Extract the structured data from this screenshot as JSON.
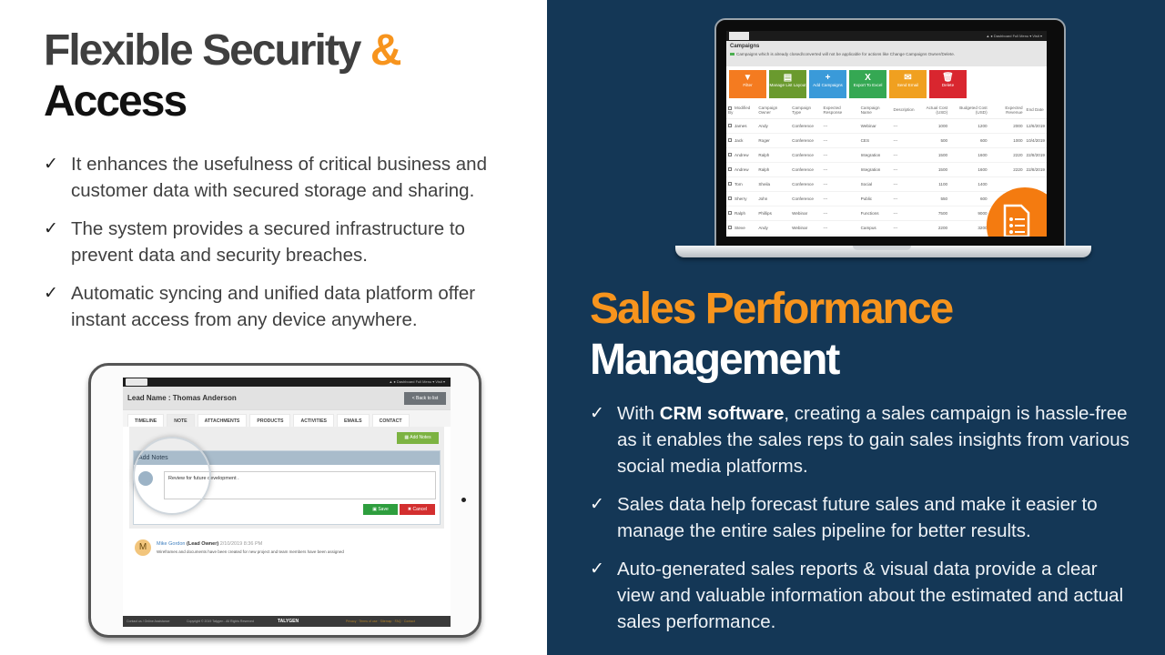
{
  "left": {
    "title_line1": "Flexible Security",
    "title_amp": "&",
    "title_line2": "Access",
    "bullets": [
      "It enhances the usefulness of critical business and customer data with secured storage and sharing.",
      "The system provides a secured infrastructure to prevent data and security breaches.",
      "Automatic syncing and unified data platform offer instant access from any device anywhere."
    ],
    "check_icon": "✓"
  },
  "tablet": {
    "topbar_right": "▲  ●  Dashboard   Full Menu ▾   Visit ▾",
    "lead_title": "Lead Name : Thomas Anderson",
    "back_button": "< Back to list",
    "tabs": [
      "TIMELINE",
      "NOTE",
      "ATTACHMENTS",
      "PRODUCTS",
      "ACTIVITIES",
      "EMAILS",
      "CONTACT"
    ],
    "active_tab": "NOTE",
    "add_notes_button": "▦ Add Notes",
    "notes_header": "Add Notes",
    "note_input_value": "Review for future development .",
    "save_button": "▣ Save",
    "cancel_button": "✖ Cancel",
    "comment": {
      "avatar_letter": "M",
      "author": "Mike Gordon",
      "role": "(Lead Owner)",
      "datetime": "2/10/2019 8:36 PM",
      "text": "Wireframes and documents have been created for new project and team members have been assigned"
    },
    "footer": {
      "left": "Contact us / Online Assistance",
      "copyright": "Copyright © 2019 Talygen - All Rights Reserved",
      "brand": "TALYGEN",
      "links": "Privacy · Terms of use · Sitemap · FAQ · Contact"
    }
  },
  "right": {
    "title_line1": "Sales Performance",
    "title_line2": "Management",
    "bullets": [
      {
        "pre": "With ",
        "bold": "CRM software",
        "post": ", creating a sales campaign is hassle-free as it enables the sales reps to gain sales insights from various social media platforms."
      },
      {
        "pre": "Sales data help forecast future sales and make it easier to manage the entire sales pipeline for better results.",
        "bold": "",
        "post": ""
      },
      {
        "pre": "Auto-generated sales reports & visual data provide a clear view and valuable information about the estimated and actual sales performance.",
        "bold": "",
        "post": ""
      }
    ],
    "check_icon": "✓"
  },
  "laptop": {
    "topbar_right": "▲  ●  Dashboard   Full Menu ▾   Visit ▾",
    "page_title": "Campaigns",
    "notice": "Campaigns which is already closed/converted will not be applicable for actions like Change Campaigns Owner/Delete.",
    "buttons": [
      {
        "icon": "▼",
        "label": "Filter",
        "color": "#f47b20"
      },
      {
        "icon": "▤",
        "label": "Manage List Layout",
        "color": "#6a9a2e"
      },
      {
        "icon": "+",
        "label": "Add Campaigns",
        "color": "#3a9ad9"
      },
      {
        "icon": "X",
        "label": "Export To Excel",
        "color": "#35a853"
      },
      {
        "icon": "✉",
        "label": "Send Email",
        "color": "#f0a020"
      },
      {
        "icon": "🗑",
        "label": "Delete",
        "color": "#d9262f"
      }
    ],
    "columns": [
      "Modified By",
      "Campaign Owner",
      "Campaign Type",
      "Expected Response",
      "Campaign Name",
      "Description",
      "Actual Cost (USD)",
      "Budgeted Cost (USD)",
      "Expected Revenue",
      "End Date"
    ],
    "rows": [
      [
        "James",
        "Andy",
        "Conference",
        "---",
        "Webinar",
        "---",
        "1000",
        "1200",
        "2000",
        "12/6/2019"
      ],
      [
        "Jack",
        "Roger",
        "Conference",
        "---",
        "CES",
        "---",
        "500",
        "600",
        "1000",
        "10/4/2019"
      ],
      [
        "Andrew",
        "Ralph",
        "Conference",
        "---",
        "Integration",
        "---",
        "1500",
        "1600",
        "2220",
        "22/8/2019"
      ],
      [
        "Andrew",
        "Ralph",
        "Conference",
        "---",
        "Integration",
        "---",
        "1500",
        "1600",
        "2220",
        "22/8/2019"
      ],
      [
        "Tom",
        "Sheila",
        "Conference",
        "---",
        "Social",
        "---",
        "1100",
        "1400",
        "",
        ""
      ],
      [
        "Sherry",
        "John",
        "Conference",
        "---",
        "Public",
        "---",
        "550",
        "600",
        "",
        ""
      ],
      [
        "Ralph",
        "Phillips",
        "Webinar",
        "---",
        "Functions",
        "---",
        "7500",
        "9000",
        "",
        ""
      ],
      [
        "Steve",
        "Andy",
        "Webinar",
        "---",
        "Campus",
        "---",
        "2200",
        "3200",
        "",
        ""
      ]
    ],
    "badge_icon": "document-list-icon"
  },
  "colors": {
    "accent_orange": "#f7941d",
    "right_bg": "#143756",
    "heading_dark": "#3f3f3f"
  }
}
